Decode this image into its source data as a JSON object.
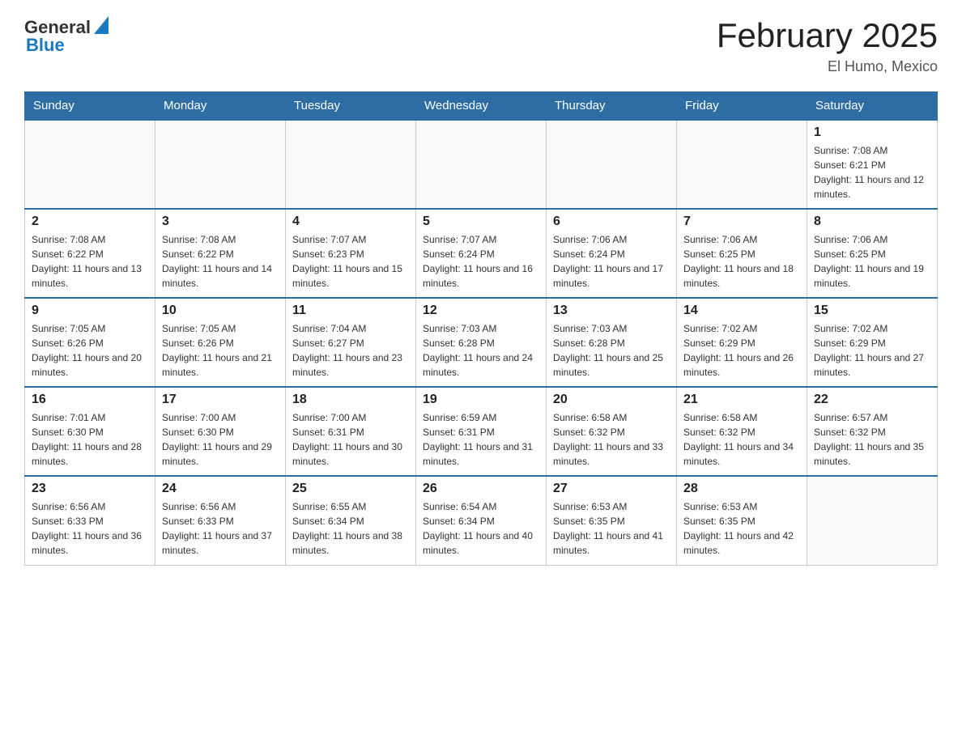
{
  "header": {
    "logo": {
      "text_general": "General",
      "text_blue": "Blue",
      "arrow_alt": "logo arrow"
    },
    "title": "February 2025",
    "location": "El Humo, Mexico"
  },
  "days_of_week": [
    "Sunday",
    "Monday",
    "Tuesday",
    "Wednesday",
    "Thursday",
    "Friday",
    "Saturday"
  ],
  "weeks": [
    [
      {
        "day": "",
        "info": ""
      },
      {
        "day": "",
        "info": ""
      },
      {
        "day": "",
        "info": ""
      },
      {
        "day": "",
        "info": ""
      },
      {
        "day": "",
        "info": ""
      },
      {
        "day": "",
        "info": ""
      },
      {
        "day": "1",
        "info": "Sunrise: 7:08 AM\nSunset: 6:21 PM\nDaylight: 11 hours and 12 minutes."
      }
    ],
    [
      {
        "day": "2",
        "info": "Sunrise: 7:08 AM\nSunset: 6:22 PM\nDaylight: 11 hours and 13 minutes."
      },
      {
        "day": "3",
        "info": "Sunrise: 7:08 AM\nSunset: 6:22 PM\nDaylight: 11 hours and 14 minutes."
      },
      {
        "day": "4",
        "info": "Sunrise: 7:07 AM\nSunset: 6:23 PM\nDaylight: 11 hours and 15 minutes."
      },
      {
        "day": "5",
        "info": "Sunrise: 7:07 AM\nSunset: 6:24 PM\nDaylight: 11 hours and 16 minutes."
      },
      {
        "day": "6",
        "info": "Sunrise: 7:06 AM\nSunset: 6:24 PM\nDaylight: 11 hours and 17 minutes."
      },
      {
        "day": "7",
        "info": "Sunrise: 7:06 AM\nSunset: 6:25 PM\nDaylight: 11 hours and 18 minutes."
      },
      {
        "day": "8",
        "info": "Sunrise: 7:06 AM\nSunset: 6:25 PM\nDaylight: 11 hours and 19 minutes."
      }
    ],
    [
      {
        "day": "9",
        "info": "Sunrise: 7:05 AM\nSunset: 6:26 PM\nDaylight: 11 hours and 20 minutes."
      },
      {
        "day": "10",
        "info": "Sunrise: 7:05 AM\nSunset: 6:26 PM\nDaylight: 11 hours and 21 minutes."
      },
      {
        "day": "11",
        "info": "Sunrise: 7:04 AM\nSunset: 6:27 PM\nDaylight: 11 hours and 23 minutes."
      },
      {
        "day": "12",
        "info": "Sunrise: 7:03 AM\nSunset: 6:28 PM\nDaylight: 11 hours and 24 minutes."
      },
      {
        "day": "13",
        "info": "Sunrise: 7:03 AM\nSunset: 6:28 PM\nDaylight: 11 hours and 25 minutes."
      },
      {
        "day": "14",
        "info": "Sunrise: 7:02 AM\nSunset: 6:29 PM\nDaylight: 11 hours and 26 minutes."
      },
      {
        "day": "15",
        "info": "Sunrise: 7:02 AM\nSunset: 6:29 PM\nDaylight: 11 hours and 27 minutes."
      }
    ],
    [
      {
        "day": "16",
        "info": "Sunrise: 7:01 AM\nSunset: 6:30 PM\nDaylight: 11 hours and 28 minutes."
      },
      {
        "day": "17",
        "info": "Sunrise: 7:00 AM\nSunset: 6:30 PM\nDaylight: 11 hours and 29 minutes."
      },
      {
        "day": "18",
        "info": "Sunrise: 7:00 AM\nSunset: 6:31 PM\nDaylight: 11 hours and 30 minutes."
      },
      {
        "day": "19",
        "info": "Sunrise: 6:59 AM\nSunset: 6:31 PM\nDaylight: 11 hours and 31 minutes."
      },
      {
        "day": "20",
        "info": "Sunrise: 6:58 AM\nSunset: 6:32 PM\nDaylight: 11 hours and 33 minutes."
      },
      {
        "day": "21",
        "info": "Sunrise: 6:58 AM\nSunset: 6:32 PM\nDaylight: 11 hours and 34 minutes."
      },
      {
        "day": "22",
        "info": "Sunrise: 6:57 AM\nSunset: 6:32 PM\nDaylight: 11 hours and 35 minutes."
      }
    ],
    [
      {
        "day": "23",
        "info": "Sunrise: 6:56 AM\nSunset: 6:33 PM\nDaylight: 11 hours and 36 minutes."
      },
      {
        "day": "24",
        "info": "Sunrise: 6:56 AM\nSunset: 6:33 PM\nDaylight: 11 hours and 37 minutes."
      },
      {
        "day": "25",
        "info": "Sunrise: 6:55 AM\nSunset: 6:34 PM\nDaylight: 11 hours and 38 minutes."
      },
      {
        "day": "26",
        "info": "Sunrise: 6:54 AM\nSunset: 6:34 PM\nDaylight: 11 hours and 40 minutes."
      },
      {
        "day": "27",
        "info": "Sunrise: 6:53 AM\nSunset: 6:35 PM\nDaylight: 11 hours and 41 minutes."
      },
      {
        "day": "28",
        "info": "Sunrise: 6:53 AM\nSunset: 6:35 PM\nDaylight: 11 hours and 42 minutes."
      },
      {
        "day": "",
        "info": ""
      }
    ]
  ]
}
